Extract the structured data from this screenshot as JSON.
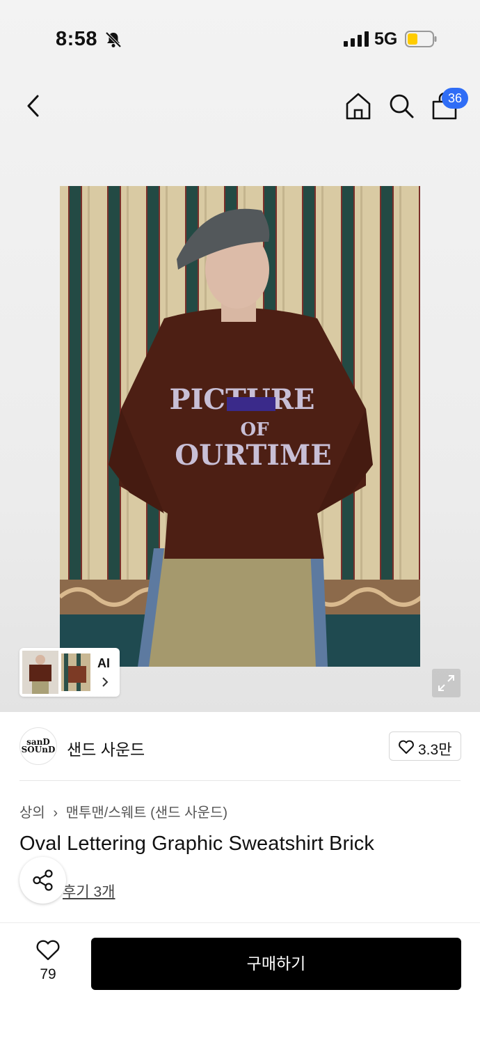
{
  "status": {
    "time": "8:58",
    "network": "5G",
    "battery_color": "#ffcc00"
  },
  "nav": {
    "cart_count": "36",
    "accent": "#2f6df6"
  },
  "gallery": {
    "ai_label": "AI"
  },
  "brand": {
    "logo_line1": "sanD",
    "logo_line2": "SOUnD",
    "name": "샌드 사운드",
    "likes": "3.3만"
  },
  "breadcrumb": {
    "items": [
      "상의",
      "맨투맨/스웨트 (샌드 사운드)"
    ]
  },
  "product": {
    "title": "Oval Lettering Graphic Sweatshirt Brick",
    "reviews": "후기 3개"
  },
  "footer": {
    "like_count": "79",
    "buy_label": "구매하기"
  }
}
